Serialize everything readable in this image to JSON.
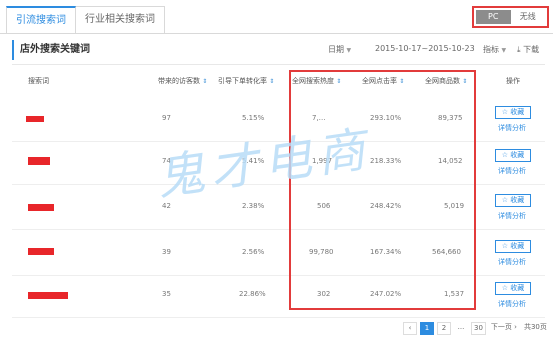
{
  "tabs": [
    {
      "label": "引流搜索词",
      "active": true
    },
    {
      "label": "行业相关搜索词",
      "active": false
    }
  ],
  "device": {
    "pc": "PC",
    "wireless": "无线"
  },
  "section_title": "店外搜索关键词",
  "date_label": "日期",
  "date_range": "2015-10-17~2015-10-23",
  "metric_label": "指标",
  "download_label": "下载",
  "columns": {
    "keyword": "搜索词",
    "visitors": "带来的访客数",
    "conversion": "引导下单转化率",
    "heat": "全网搜索热度",
    "ctr": "全网点击率",
    "products": "全网商品数",
    "action": "操作"
  },
  "rows": [
    {
      "visitors": "97",
      "conversion": "5.15%",
      "heat": "7,…",
      "ctr": "293.10%",
      "products": "89,375"
    },
    {
      "visitors": "74",
      "conversion": "5.41%",
      "heat": "1,997",
      "ctr": "218.33%",
      "products": "14,052"
    },
    {
      "visitors": "42",
      "conversion": "2.38%",
      "heat": "506",
      "ctr": "248.42%",
      "products": "5,019"
    },
    {
      "visitors": "39",
      "conversion": "2.56%",
      "heat": "99,780",
      "ctr": "167.34%",
      "products": "564,660"
    },
    {
      "visitors": "35",
      "conversion": "22.86%",
      "heat": "302",
      "ctr": "247.02%",
      "products": "1,537"
    }
  ],
  "actions": {
    "favorite": "☆ 收藏",
    "detail": "详情分析"
  },
  "watermark": "鬼才电商",
  "pagination": {
    "prev": "‹",
    "pages": [
      "1",
      "2",
      "...",
      "30"
    ],
    "next": "下一页 ›",
    "total": "共30页"
  },
  "colors": {
    "accent": "#2d8ce0",
    "highlight": "#e23b3b",
    "redaction": "#e8262a"
  }
}
